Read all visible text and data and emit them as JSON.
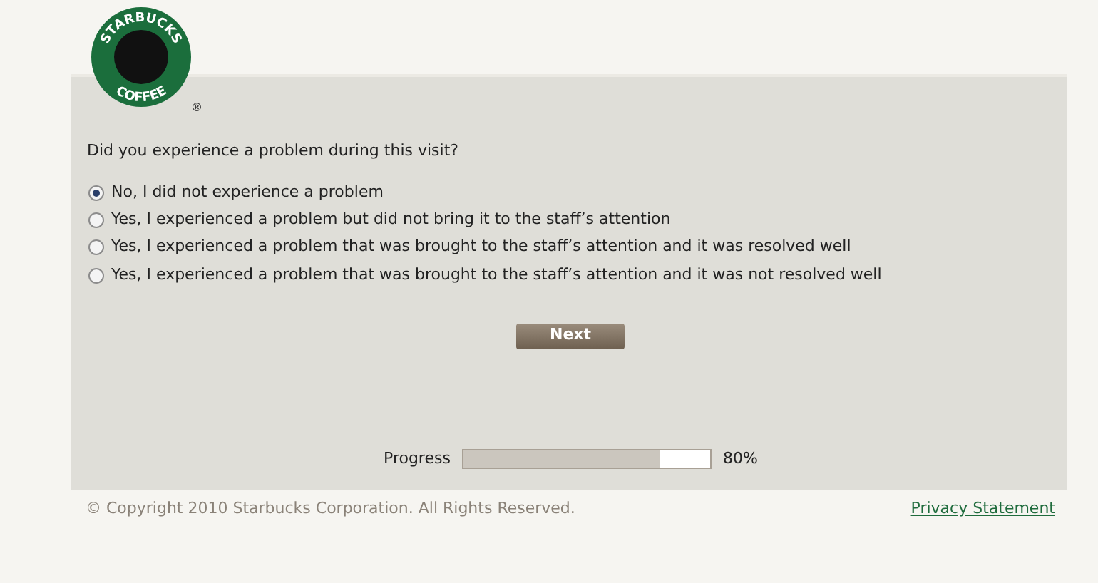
{
  "logo": {
    "top_text": "STARBUCKS",
    "bottom_text": "COFFEE",
    "mark": "®"
  },
  "question": "Did you experience a problem during this visit?",
  "options": [
    {
      "label": "No, I did not experience a problem",
      "selected": true
    },
    {
      "label": "Yes, I experienced a problem but did not bring it to the staff’s attention",
      "selected": false
    },
    {
      "label": "Yes, I experienced a problem that was brought to the staff’s attention and it was resolved well",
      "selected": false
    },
    {
      "label": "Yes, I experienced a problem that was brought to the staff’s attention and it was not resolved well",
      "selected": false
    }
  ],
  "next_button": "Next",
  "progress": {
    "label": "Progress",
    "level": 0.8,
    "reading": "80%"
  },
  "footer": {
    "copyright": "© Copyright 2010 Starbucks Corporation. All Rights Reserved.",
    "privacy_link": "Privacy Statement"
  }
}
